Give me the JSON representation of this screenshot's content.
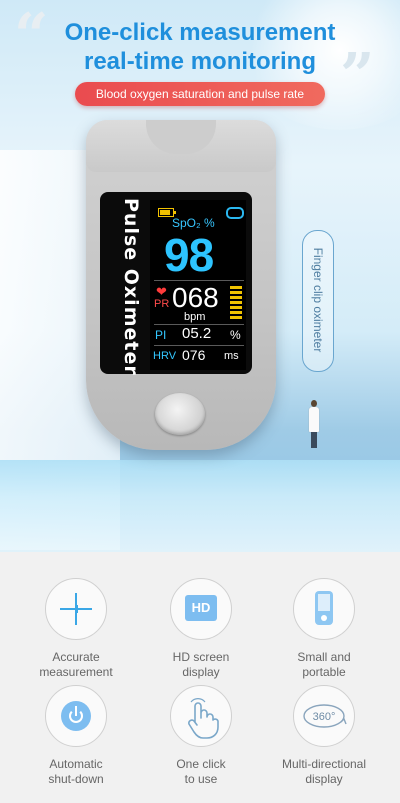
{
  "hero": {
    "headline_line1": "One-click measurement",
    "headline_line2": "real-time monitoring",
    "pill": "Blood oxygen saturation and pulse rate",
    "side_tag": "Finger clip oximeter"
  },
  "device": {
    "brand_label": "Pulse Oximeter",
    "spo2_label": "SpO₂ %",
    "spo2_value": "98",
    "pr_label": "PR",
    "pr_value": "068",
    "pr_unit": "bpm",
    "pi_label": "PI",
    "pi_value": "05.2",
    "pi_unit": "%",
    "hrv_label": "HRV",
    "hrv_value": "076",
    "hrv_unit": "ms"
  },
  "features": [
    {
      "label_line1": "Accurate",
      "label_line2": "measurement",
      "icon": "crosshair-icon"
    },
    {
      "label_line1": "HD screen",
      "label_line2": "display",
      "icon": "hd-icon",
      "icon_text": "HD"
    },
    {
      "label_line1": "Small and",
      "label_line2": "portable",
      "icon": "device-icon"
    },
    {
      "label_line1": "Automatic",
      "label_line2": "shut-down",
      "icon": "power-icon"
    },
    {
      "label_line1": "One click",
      "label_line2": "to use",
      "icon": "tap-hand-icon"
    },
    {
      "label_line1": "Multi-directional",
      "label_line2": "display",
      "icon": "rotate-360-icon",
      "icon_text": "360°"
    }
  ],
  "colors": {
    "accent": "#1f8fdc",
    "pill": "#ea4b4f",
    "icon": "#7dbdf0"
  }
}
